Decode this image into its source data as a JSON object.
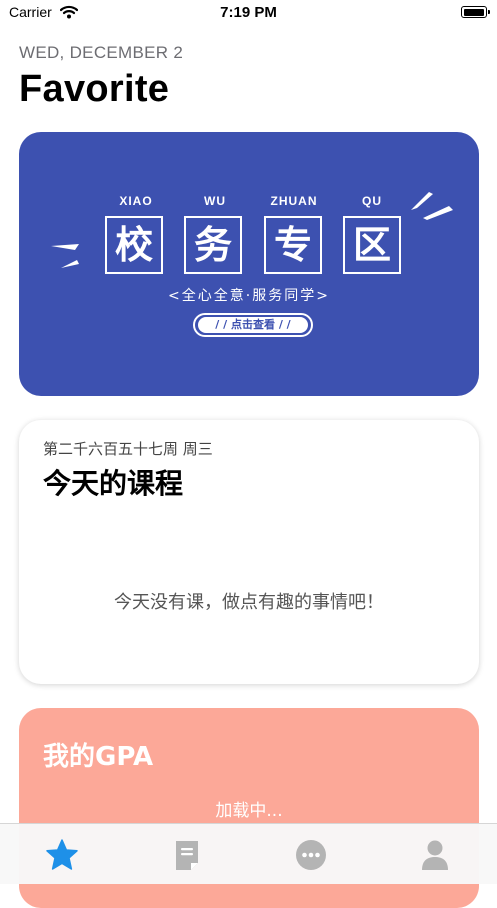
{
  "status_bar": {
    "carrier": "Carrier",
    "time": "7:19 PM",
    "battery_level": 1.0
  },
  "header": {
    "date": "WED, DECEMBER 2",
    "title": "Favorite"
  },
  "banner": {
    "background": "#3d51b0",
    "pinyin": [
      "XIAO",
      "WU",
      "ZHUAN",
      "QU"
    ],
    "characters": [
      "校",
      "务",
      "专",
      "区"
    ],
    "subtitle": "<全心全意·服务同学>",
    "cta_label": "/ / 点击查看 / /"
  },
  "course_card": {
    "week_label": "第二千六百五十七周 周三",
    "title": "今天的课程",
    "empty_message": "今天没有课，做点有趣的事情吧！"
  },
  "gpa_card": {
    "background": "#fca898",
    "title": "我的GPA",
    "loading": "加载中..."
  },
  "tab_bar": {
    "active_color": "#1e90e8",
    "inactive_color": "#b4b4b4",
    "tabs": [
      {
        "icon": "star-icon",
        "active": true
      },
      {
        "icon": "document-icon",
        "active": false
      },
      {
        "icon": "chat-bubble-icon",
        "active": false
      },
      {
        "icon": "person-icon",
        "active": false
      }
    ]
  }
}
